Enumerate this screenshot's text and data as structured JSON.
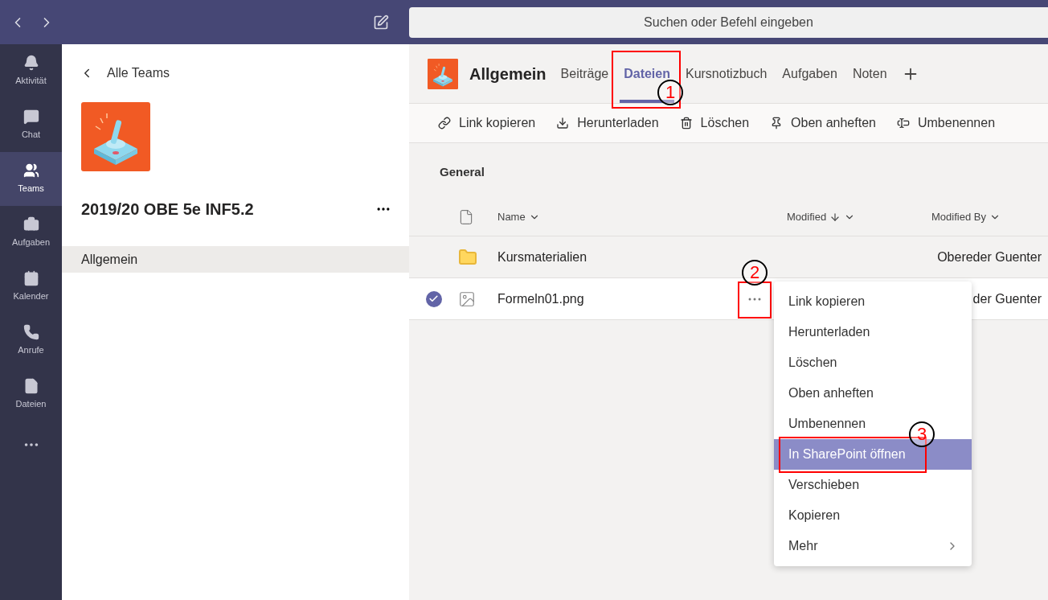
{
  "search": {
    "placeholder": "Suchen oder Befehl eingeben"
  },
  "rail": [
    {
      "label": "Aktivität",
      "selected": false
    },
    {
      "label": "Chat",
      "selected": false
    },
    {
      "label": "Teams",
      "selected": true
    },
    {
      "label": "Aufgaben",
      "selected": false
    },
    {
      "label": "Kalender",
      "selected": false
    },
    {
      "label": "Anrufe",
      "selected": false
    },
    {
      "label": "Dateien",
      "selected": false
    }
  ],
  "team_panel": {
    "back": "Alle Teams",
    "team_name": "2019/20 OBE 5e INF5.2",
    "channels": [
      {
        "label": "Allgemein",
        "selected": true
      }
    ]
  },
  "channel": {
    "title": "Allgemein",
    "tabs": [
      {
        "label": "Beiträge",
        "selected": false
      },
      {
        "label": "Dateien",
        "selected": true,
        "annotation": "1"
      },
      {
        "label": "Kursnotizbuch",
        "selected": false
      },
      {
        "label": "Aufgaben",
        "selected": false
      },
      {
        "label": "Noten",
        "selected": false
      }
    ]
  },
  "toolbar": [
    "Link kopieren",
    "Herunterladen",
    "Löschen",
    "Oben anheften",
    "Umbenennen"
  ],
  "folder": "General",
  "table": {
    "columns": [
      "Name",
      "Modified",
      "Modified By"
    ],
    "rows": [
      {
        "kind": "folder",
        "name": "Kursmaterialien",
        "modified_by": "Obereder Guenter",
        "selected": false
      },
      {
        "kind": "image",
        "name": "Formeln01.png",
        "modified_by": "der Guenter",
        "selected": true,
        "action_annotation": "2"
      }
    ]
  },
  "context_menu": [
    {
      "label": "Link kopieren",
      "selected": false,
      "submenu": false
    },
    {
      "label": "Herunterladen",
      "selected": false,
      "submenu": false
    },
    {
      "label": "Löschen",
      "selected": false,
      "submenu": false
    },
    {
      "label": "Oben anheften",
      "selected": false,
      "submenu": false
    },
    {
      "label": "Umbenennen",
      "selected": false,
      "submenu": false
    },
    {
      "label": "In SharePoint öffnen",
      "selected": true,
      "submenu": false,
      "annotation": "3"
    },
    {
      "label": "Verschieben",
      "selected": false,
      "submenu": false
    },
    {
      "label": "Kopieren",
      "selected": false,
      "submenu": false
    },
    {
      "label": "Mehr",
      "selected": false,
      "submenu": true
    }
  ]
}
